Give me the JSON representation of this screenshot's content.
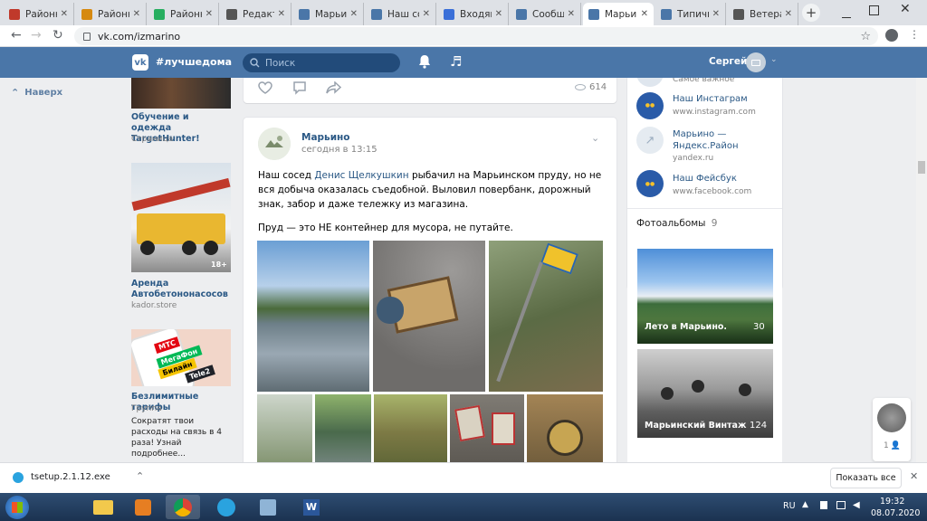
{
  "browser": {
    "tabs": [
      {
        "label": "Районн",
        "icon": "vk-group-icon",
        "color": "#c0392b"
      },
      {
        "label": "Районн",
        "icon": "owl-icon",
        "color": "#d68910"
      },
      {
        "label": "Районн",
        "icon": "flag-icon",
        "color": "#27ae60"
      },
      {
        "label": "Редакто",
        "icon": "globe-icon",
        "color": "#555555"
      },
      {
        "label": "Марьин",
        "icon": "vk-icon",
        "color": "#4a76a8"
      },
      {
        "label": "Наш со",
        "icon": "vk-icon",
        "color": "#4a76a8"
      },
      {
        "label": "Входящ",
        "icon": "mail-icon",
        "color": "#3a6fd8"
      },
      {
        "label": "Сообщ",
        "icon": "vk-icon",
        "color": "#4a76a8"
      },
      {
        "label": "Марьин",
        "icon": "vk-icon",
        "color": "#4a76a8"
      },
      {
        "label": "Типичн",
        "icon": "vk-icon",
        "color": "#4a76a8"
      },
      {
        "label": "Ветера",
        "icon": "globe-icon",
        "color": "#555555"
      }
    ],
    "url": "vk.com/izmarino"
  },
  "vk_header": {
    "hashtag": "#лучшедома",
    "search_placeholder": "Поиск",
    "user_name": "Сергей"
  },
  "left_column": {
    "back_label": "Наверх"
  },
  "ads": [
    {
      "title": "Обучение и одежда TargetHunter!",
      "subtitle": "Страница"
    },
    {
      "title": "Аренда Автобетононасосов",
      "subtitle": "kador.store",
      "badge": "18+"
    },
    {
      "title": "Безлимитные тарифы",
      "subtitle": "Группа",
      "description": "Сократят твои расходы на связь в 4 раза! Узнай подробнее...",
      "image_text": [
        "МТС",
        "МегаФон",
        "Билайн",
        "Tele2"
      ]
    }
  ],
  "prev_post": {
    "views": "614"
  },
  "post": {
    "author": "Марьино",
    "time": "сегодня в 13:15",
    "text_before": "Наш сосед ",
    "mention": "Денис Щелкушкин",
    "text_after": " рыбачил на Марьинском пруду, но не вся добыча оказалась съедобной. Выловил повербанк, дорожный знак, забор и даже тележку из магазина.",
    "text_second": "Пруд — это НЕ контейнер для мусора, не путайте."
  },
  "links": [
    {
      "title": "",
      "subtitle": "Самое важное"
    },
    {
      "title": "Наш Инстаграм",
      "subtitle": "www.instagram.com"
    },
    {
      "title": "Марьино — Яндекс.Район",
      "subtitle": "yandex.ru"
    },
    {
      "title": "Наш Фейсбук",
      "subtitle": "www.facebook.com"
    }
  ],
  "albums_section": {
    "label": "Фотоальбомы",
    "count": "9",
    "albums": [
      {
        "title": "Лето в Марьино.",
        "count": "30"
      },
      {
        "title": "Марьинский Винтаж",
        "count": "124"
      }
    ]
  },
  "chat_widget": {
    "count": "1"
  },
  "download_bar": {
    "filename": "tsetup.2.1.12.exe",
    "show_all": "Показать все"
  },
  "taskbar": {
    "lang": "RU",
    "time": "19:32",
    "date": "08.07.2020"
  }
}
